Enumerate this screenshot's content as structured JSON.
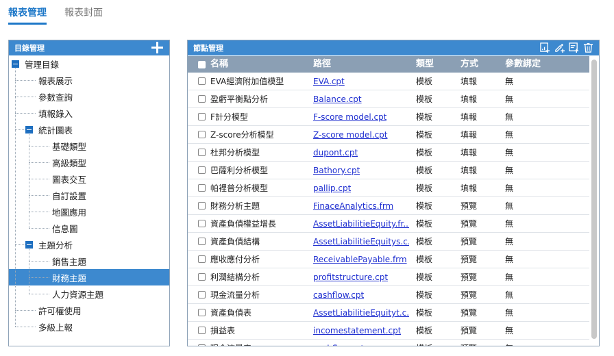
{
  "tabs": [
    {
      "label": "報表管理",
      "active": true
    },
    {
      "label": "報表封面",
      "active": false
    }
  ],
  "left_panel": {
    "title": "目錄管理",
    "add_icon": "plus-icon",
    "tree": [
      {
        "label": "管理目錄",
        "level": 0,
        "expanded": true
      },
      {
        "label": "報表展示",
        "level": 1
      },
      {
        "label": "參數查詢",
        "level": 1
      },
      {
        "label": "填報錄入",
        "level": 1
      },
      {
        "label": "統計圖表",
        "level": 1,
        "expanded": true
      },
      {
        "label": "基礎類型",
        "level": 2
      },
      {
        "label": "高級類型",
        "level": 2
      },
      {
        "label": "圖表交互",
        "level": 2
      },
      {
        "label": "自訂設置",
        "level": 2
      },
      {
        "label": "地圖應用",
        "level": 2
      },
      {
        "label": "信息圖",
        "level": 2
      },
      {
        "label": "主題分析",
        "level": 1,
        "expanded": true
      },
      {
        "label": "銷售主題",
        "level": 2
      },
      {
        "label": "財務主題",
        "level": 2,
        "selected": true
      },
      {
        "label": "人力資源主題",
        "level": 2
      },
      {
        "label": "許可權使用",
        "level": 1
      },
      {
        "label": "多級上報",
        "level": 1
      }
    ]
  },
  "right_panel": {
    "title": "節點管理",
    "tool_icons": [
      "add-report-icon",
      "edit-icon",
      "add-list-icon",
      "delete-icon"
    ],
    "columns": [
      "名稱",
      "路徑",
      "類型",
      "方式",
      "參數綁定"
    ],
    "rows": [
      {
        "name": "EVA經濟附加值模型",
        "path": "EVA.cpt",
        "type": "模板",
        "mode": "填報",
        "param": "無"
      },
      {
        "name": "盈虧平衡點分析",
        "path": "Balance.cpt",
        "type": "模板",
        "mode": "填報",
        "param": "無"
      },
      {
        "name": "F計分模型",
        "path": "F-score model.cpt",
        "type": "模板",
        "mode": "填報",
        "param": "無"
      },
      {
        "name": "Z-score分析模型",
        "path": "Z-score model.cpt",
        "type": "模板",
        "mode": "填報",
        "param": "無"
      },
      {
        "name": "杜邦分析模型",
        "path": "dupont.cpt",
        "type": "模板",
        "mode": "填報",
        "param": "無"
      },
      {
        "name": "巴薩利分析模型",
        "path": "Bathory.cpt",
        "type": "模板",
        "mode": "填報",
        "param": "無"
      },
      {
        "name": "帕裡普分析模型",
        "path": "pallip.cpt",
        "type": "模板",
        "mode": "填報",
        "param": "無"
      },
      {
        "name": "財務分析主題",
        "path": "FinaceAnalytics.frm",
        "type": "模板",
        "mode": "預覽",
        "param": "無"
      },
      {
        "name": "資產負債權益增長",
        "path": "AssetLiabilitieEquity.fr...",
        "type": "模板",
        "mode": "預覽",
        "param": "無"
      },
      {
        "name": "資產負債結構",
        "path": "AssetLiabilitieEquitys.c...",
        "type": "模板",
        "mode": "預覽",
        "param": "無"
      },
      {
        "name": "應收應付分析",
        "path": "ReceivablePayable.frm",
        "type": "模板",
        "mode": "預覽",
        "param": "無"
      },
      {
        "name": "利潤結構分析",
        "path": "profitstructure.cpt",
        "type": "模板",
        "mode": "預覽",
        "param": "無"
      },
      {
        "name": "現金流量分析",
        "path": "cashflow.cpt",
        "type": "模板",
        "mode": "預覽",
        "param": "無"
      },
      {
        "name": "資產負債表",
        "path": "AssetLiabilitieEquityt.c...",
        "type": "模板",
        "mode": "預覽",
        "param": "無"
      },
      {
        "name": "損益表",
        "path": "incomestatement.cpt",
        "type": "模板",
        "mode": "預覽",
        "param": "無"
      },
      {
        "name": "現金流量表",
        "path": "cashflow.cpt",
        "type": "模板",
        "mode": "預覽",
        "param": "無"
      }
    ]
  },
  "colors": {
    "accent": "#1e78c8",
    "panel_header": "#3d89cf",
    "table_header": "#8b9fb4",
    "link": "#1f2fd0",
    "selected_row": "#3d89cf"
  }
}
